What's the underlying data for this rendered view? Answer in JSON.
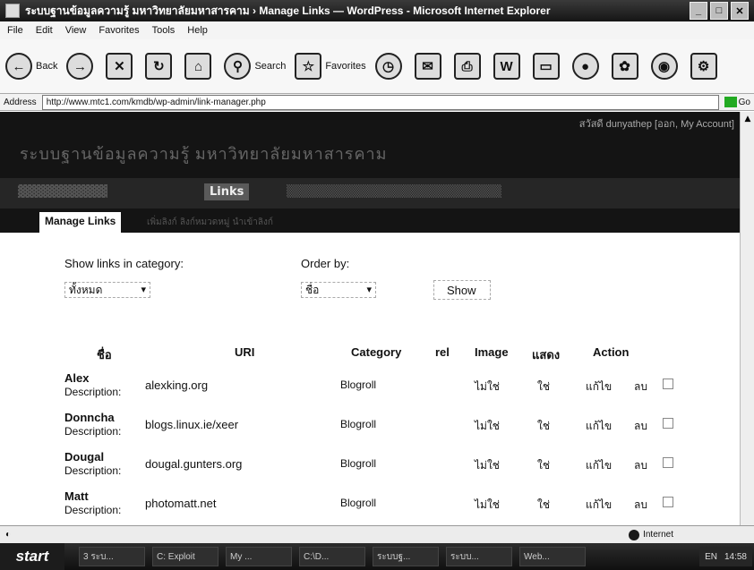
{
  "window": {
    "title": "ระบบฐานข้อมูลความรู้ มหาวิทยาลัยมหาสารคาม › Manage Links — WordPress - Microsoft Internet Explorer",
    "controls": [
      "_",
      "□",
      "✕"
    ]
  },
  "menu": [
    "File",
    "Edit",
    "View",
    "Favorites",
    "Tools",
    "Help"
  ],
  "toolbar": {
    "back": "Back",
    "search": "Search",
    "favorites": "Favorites"
  },
  "address": {
    "label": "Address",
    "url": "http://www.mtc1.com/kmdb/wp-admin/link-manager.php",
    "go": "Go"
  },
  "wp": {
    "user_bar": "สวัสดี dunyathep [ออก, My Account]",
    "site_title": "ระบบฐานข้อมูลความรู้ มหาวิทยาลัยมหาสารคาม",
    "active_menu": "Links",
    "submenu_current": "Manage Links",
    "submenu_others": "เพิ่มลิงก์  ลิงก์หมวดหมู่  นำเข้าลิงก์"
  },
  "filter": {
    "category_label": "Show links in category:",
    "category_value": "ทั้งหมด",
    "order_label": "Order by:",
    "order_value": "ชื่อ",
    "show_button": "Show"
  },
  "table": {
    "headers": {
      "name": "ชื่อ",
      "uri": "URI",
      "category": "Category",
      "rel": "rel",
      "image": "Image",
      "visible": "แสดง",
      "action": "Action"
    },
    "desc_label": "Description:",
    "edit_label": "แก้ไข",
    "delete_label": "ลบ",
    "rows": [
      {
        "name": "Alex",
        "uri": "alexking.org",
        "category": "Blogroll",
        "image": "ไม่ใช่",
        "visible": "ใช่"
      },
      {
        "name": "Donncha",
        "uri": "blogs.linux.ie/xeer",
        "category": "Blogroll",
        "image": "ไม่ใช่",
        "visible": "ใช่"
      },
      {
        "name": "Dougal",
        "uri": "dougal.gunters.org",
        "category": "Blogroll",
        "image": "ไม่ใช่",
        "visible": "ใช่"
      },
      {
        "name": "Matt",
        "uri": "photomatt.net",
        "category": "Blogroll",
        "image": "ไม่ใช่",
        "visible": "ใช่"
      }
    ]
  },
  "status": {
    "zone": "Internet"
  },
  "taskbar": {
    "start": "start",
    "tasks": [
      "3 ระบ...",
      "C: Exploit",
      "My ...",
      "C:\\D...",
      "ระบบฐ...",
      "ระบบ...",
      "Web..."
    ],
    "lang": "EN",
    "clock": "14:58"
  }
}
